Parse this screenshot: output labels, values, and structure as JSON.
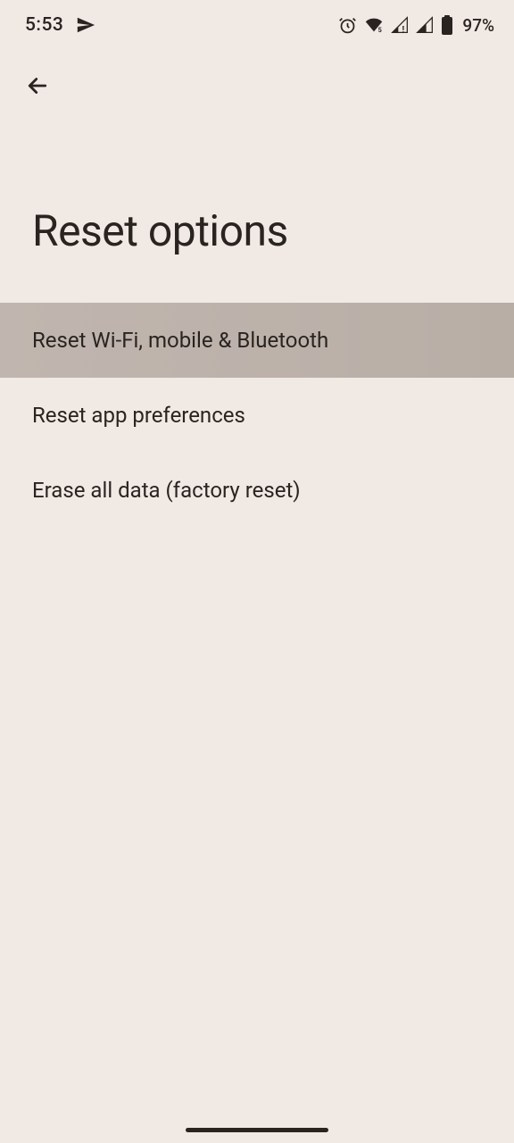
{
  "status_bar": {
    "time": "5:53",
    "battery_percent": "97%"
  },
  "page": {
    "title": "Reset options"
  },
  "options": [
    {
      "label": "Reset Wi-Fi, mobile & Bluetooth",
      "highlighted": true
    },
    {
      "label": "Reset app preferences",
      "highlighted": false
    },
    {
      "label": "Erase all data (factory reset)",
      "highlighted": false
    }
  ]
}
